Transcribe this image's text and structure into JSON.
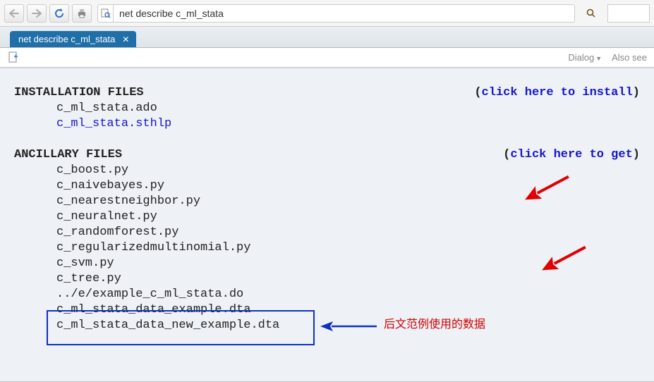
{
  "toolbar": {
    "address_value": "net describe c_ml_stata"
  },
  "tab": {
    "title": "net describe c_ml_stata"
  },
  "subbar": {
    "dialog_label": "Dialog",
    "also_see_label": "Also see"
  },
  "content": {
    "section1_title": "INSTALLATION FILES",
    "section1_action": "click here to install",
    "section1_files": [
      {
        "name": "c_ml_stata.ado",
        "link": false
      },
      {
        "name": "c_ml_stata.sthlp",
        "link": true
      }
    ],
    "section2_title": "ANCILLARY FILES",
    "section2_action": "click here to get",
    "section2_files": [
      "c_boost.py",
      "c_naivebayes.py",
      "c_nearestneighbor.py",
      "c_neuralnet.py",
      "c_randomforest.py",
      "c_regularizedmultinomial.py",
      "c_svm.py",
      "c_tree.py",
      "../e/example_c_ml_stata.do",
      "c_ml_stata_data_example.dta",
      "c_ml_stata_data_new_example.dta"
    ]
  },
  "annotation": {
    "text": "后文范例使用的数据"
  }
}
